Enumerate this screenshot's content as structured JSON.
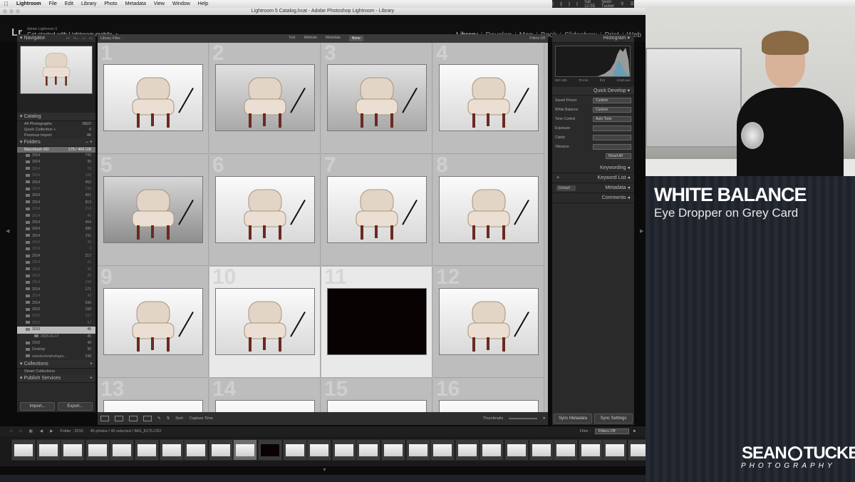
{
  "menubar": {
    "app": "Lightroom",
    "items": [
      "File",
      "Edit",
      "Library",
      "Photo",
      "Metadata",
      "View",
      "Window",
      "Help"
    ],
    "clock": "Sat 12:55",
    "user": "Sean Tucker"
  },
  "window": {
    "title": "Lightroom 5 Catalog.lrcat - Adobe Photoshop Lightroom - Library"
  },
  "identity": {
    "logo": "Lr",
    "line1": "Adobe Lightroom 5",
    "line2": "Get started with Lightroom mobile"
  },
  "modules": [
    "Library",
    "Develop",
    "Map",
    "Book",
    "Slideshow",
    "Print",
    "Web"
  ],
  "active_module": "Library",
  "left_panel": {
    "navigator": "Navigator",
    "nav_zoom": [
      "FIT",
      "FILL",
      "1:1",
      "3:1"
    ],
    "catalog": "Catalog",
    "catalog_items": [
      {
        "label": "All Photographs",
        "count": "6822"
      },
      {
        "label": "Quick Collection +",
        "count": "0"
      },
      {
        "label": "Previous Import",
        "count": "46"
      }
    ],
    "folders": "Folders",
    "drive": {
      "label": "Macintosh HD",
      "count": "175 / 466 GB"
    },
    "folder_rows": [
      {
        "label": "2014",
        "count": "743"
      },
      {
        "label": "2014",
        "count": "35"
      },
      {
        "label": "2014",
        "count": "19"
      },
      {
        "label": "2014",
        "count": "168"
      },
      {
        "label": "2014",
        "count": "452"
      },
      {
        "label": "2014",
        "count": "239"
      },
      {
        "label": "2014",
        "count": "401"
      },
      {
        "label": "2014",
        "count": "813"
      },
      {
        "label": "2014",
        "count": "214"
      },
      {
        "label": "2014",
        "count": "40"
      },
      {
        "label": "2014",
        "count": "454"
      },
      {
        "label": "2014",
        "count": "585"
      },
      {
        "label": "2014",
        "count": "211"
      },
      {
        "label": "2014",
        "count": "45"
      },
      {
        "label": "2014",
        "count": "9"
      },
      {
        "label": "2014",
        "count": "217"
      },
      {
        "label": "2014",
        "count": "21"
      },
      {
        "label": "2014",
        "count": "48"
      },
      {
        "label": "2014",
        "count": "28"
      },
      {
        "label": "2014",
        "count": "238"
      },
      {
        "label": "2014",
        "count": "171"
      },
      {
        "label": "2014",
        "count": "48"
      },
      {
        "label": "2014",
        "count": "636"
      },
      {
        "label": "2015",
        "count": "158"
      },
      {
        "label": "2015",
        "count": "227"
      },
      {
        "label": "2015",
        "count": "82"
      },
      {
        "label": "2015",
        "count": "45"
      },
      {
        "label": "2015-01-17",
        "count": "45"
      },
      {
        "label": "2015",
        "count": "48"
      },
      {
        "label": "Desktop",
        "count": "95"
      },
      {
        "label": "seantuckerphotogra...",
        "count": "248"
      }
    ],
    "collections": "Collections",
    "smart_collections": "Smart Collections",
    "publish": "Publish Services",
    "import_btn": "Import...",
    "export_btn": "Export..."
  },
  "filter_bar": {
    "label": "Library Filter :",
    "options": [
      "Text",
      "Attribute",
      "Metadata",
      "None"
    ],
    "active": "None",
    "right": "Filters Off"
  },
  "grid": {
    "cells": [
      "1",
      "2",
      "3",
      "4",
      "5",
      "6",
      "7",
      "8",
      "9",
      "10",
      "11",
      "12",
      "13",
      "14",
      "15",
      "16"
    ]
  },
  "toolbar": {
    "sort_label": "Sort:",
    "sort_value": "Capture Time",
    "thumbnails": "Thumbnails"
  },
  "right_panel": {
    "histogram": "Histogram",
    "cam_info": [
      "ISO 100",
      "70 mm",
      "f/13",
      "1/125 sec"
    ],
    "quick_develop": "Quick Develop",
    "saved_preset": "Saved Preset",
    "saved_preset_val": "Custom",
    "white_balance": "White Balance",
    "white_balance_val": "Custom",
    "tone_control": "Tone Control",
    "auto_tone": "Auto Tone",
    "exposure": "Exposure",
    "clarity": "Clarity",
    "vibrance": "Vibrance",
    "reset_all": "Reset All",
    "keywording": "Keywording",
    "keyword_list": "Keyword List",
    "default": "Default",
    "metadata": "Metadata",
    "comments": "Comments",
    "sync_metadata": "Sync Metadata",
    "sync_settings": "Sync Settings"
  },
  "secondary": {
    "folder": "Folder : 2015",
    "info": "45 photos / 45 selected / IMG_8175.CR2",
    "filter_label": "Filter :",
    "filter_value": "Filters Off"
  },
  "overlay": {
    "title": "WHITE BALANCE",
    "subtitle": "Eye Dropper on Grey Card",
    "logo_a": "SEAN",
    "logo_b": "TUCKER",
    "logo_sub": "PHOTOGRAPHY"
  }
}
